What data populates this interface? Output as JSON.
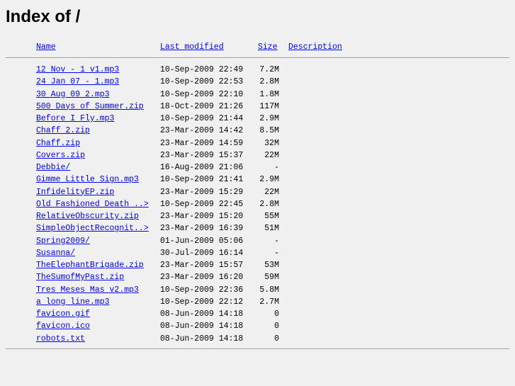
{
  "page": {
    "title": "Index of /"
  },
  "columns": {
    "name": "Name",
    "last_modified": "Last modified",
    "size": "Size",
    "description": "Description"
  },
  "files": [
    {
      "name": "12 Nov - 1 v1.mp3",
      "modified": "10-Sep-2009 22:49",
      "size": "7.2M"
    },
    {
      "name": "24 Jan 07 - 1.mp3",
      "modified": "10-Sep-2009 22:53",
      "size": "2.8M"
    },
    {
      "name": "30 Aug 09 2.mp3",
      "modified": "10-Sep-2009 22:10",
      "size": "1.8M"
    },
    {
      "name": "500 Days of Summer.zip",
      "modified": "18-Oct-2009 21:26",
      "size": "117M"
    },
    {
      "name": "Before I Fly.mp3",
      "modified": "10-Sep-2009 21:44",
      "size": "2.9M"
    },
    {
      "name": "Chaff 2.zip",
      "modified": "23-Mar-2009 14:42",
      "size": "8.5M"
    },
    {
      "name": "Chaff.zip",
      "modified": "23-Mar-2009 14:59",
      "size": "32M"
    },
    {
      "name": "Covers.zip",
      "modified": "23-Mar-2009 15:37",
      "size": "22M"
    },
    {
      "name": "Debbie/",
      "modified": "16-Aug-2009 21:06",
      "size": "-"
    },
    {
      "name": "Gimme Little Sign.mp3",
      "modified": "10-Sep-2009 21:41",
      "size": "2.9M"
    },
    {
      "name": "InfidelityEP.zip",
      "modified": "23-Mar-2009 15:29",
      "size": "22M"
    },
    {
      "name": "Old Fashioned Death ..>",
      "modified": "10-Sep-2009 22:45",
      "size": "2.8M"
    },
    {
      "name": "RelativeObscurity.zip",
      "modified": "23-Mar-2009 15:20",
      "size": "55M"
    },
    {
      "name": "SimpleObjectRecognit..>",
      "modified": "23-Mar-2009 16:39",
      "size": "51M"
    },
    {
      "name": "Spring2009/",
      "modified": "01-Jun-2009 05:06",
      "size": "-"
    },
    {
      "name": "Susanna/",
      "modified": "30-Jul-2009 16:14",
      "size": "-"
    },
    {
      "name": "TheElephantBrigade.zip",
      "modified": "23-Mar-2009 15:57",
      "size": "53M"
    },
    {
      "name": "TheSumofMyPast.zip",
      "modified": "23-Mar-2009 16:20",
      "size": "59M"
    },
    {
      "name": "Tres Meses Mas v2.mp3",
      "modified": "10-Sep-2009 22:36",
      "size": "5.8M"
    },
    {
      "name": "a long line.mp3",
      "modified": "10-Sep-2009 22:12",
      "size": "2.7M"
    },
    {
      "name": "favicon.gif",
      "modified": "08-Jun-2009 14:18",
      "size": "0"
    },
    {
      "name": "favicon.ico",
      "modified": "08-Jun-2009 14:18",
      "size": "0"
    },
    {
      "name": "robots.txt",
      "modified": "08-Jun-2009 14:18",
      "size": "0"
    }
  ]
}
